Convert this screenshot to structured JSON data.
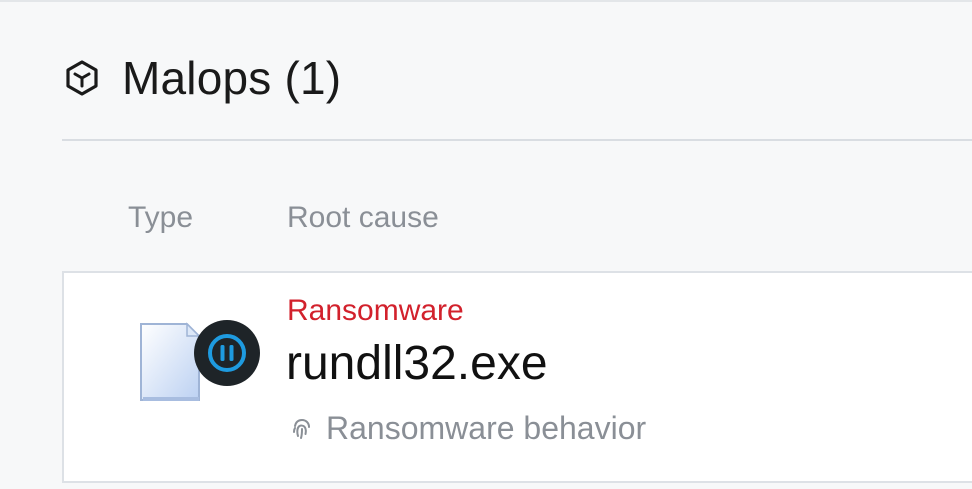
{
  "header": {
    "title": "Malops (1)",
    "icon": "malop-hexagon-icon"
  },
  "table": {
    "columns": [
      "Type",
      "Root cause"
    ]
  },
  "malop": {
    "type_icon": "file-icon",
    "status_icon": "pause-icon",
    "category": "Ransomware",
    "root_cause": "rundll32.exe",
    "behavior_icon": "fingerprint-icon",
    "behavior": "Ransomware behavior"
  },
  "colors": {
    "category": "#d2212c",
    "status_badge": "#1e2428",
    "status_accent": "#1e9be0",
    "muted_text": "#8a8f96"
  }
}
